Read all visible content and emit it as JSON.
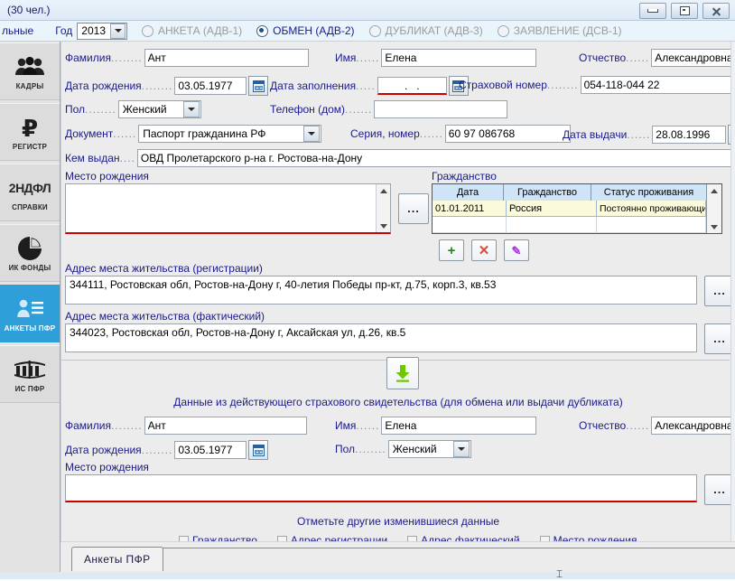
{
  "window": {
    "title": "(30 чел.)",
    "buttons": {
      "minimize": "minimize-button",
      "restore": "restore-button",
      "close": "close-button"
    }
  },
  "toolbar": {
    "truncated_label": "льные",
    "year_label": "Год",
    "year_value": "2013",
    "form_types": [
      {
        "label": "АНКЕТА (АДВ-1)",
        "selected": false
      },
      {
        "label": "ОБМЕН (АДВ-2)",
        "selected": true
      },
      {
        "label": "ДУБЛИКАТ (АДВ-3)",
        "selected": false
      },
      {
        "label": "ЗАЯВЛЕНИЕ (ДСВ-1)",
        "selected": false
      }
    ]
  },
  "sidebar": {
    "items": [
      {
        "label": "КАДРЫ",
        "icon": "people-icon",
        "selected": false
      },
      {
        "label": "РЕГИСТР",
        "icon": "ruble-icon",
        "selected": false
      },
      {
        "label": "СПРАВКИ",
        "top_text": "2НДФЛ",
        "icon": "text-2ndfl-icon",
        "selected": false
      },
      {
        "label": "ИК ФОНДЫ",
        "icon": "pie-chart-icon",
        "selected": false
      },
      {
        "label": "АНКЕТЫ ПФР",
        "icon": "id-card-icon",
        "selected": true
      },
      {
        "label": "ИС ПФР",
        "icon": "pfr-logo-icon",
        "selected": false
      }
    ]
  },
  "form": {
    "surname": {
      "label": "Фамилия",
      "dots": "........",
      "value": "Ант"
    },
    "firstname": {
      "label": "Имя",
      "dots": "......",
      "value": "Елена"
    },
    "patronymic": {
      "label": "Отчество",
      "dots": "......",
      "value": "Александровна"
    },
    "birthdate": {
      "label": "Дата рождения",
      "dots": "........",
      "value": "03.05.1977",
      "icon": "calendar-icon"
    },
    "filldate": {
      "label": "Дата заполнения",
      "dots": ".....",
      "value": ".   .",
      "icon": "calendar-icon",
      "error": true
    },
    "insurance_number": {
      "label": "Страховой номер",
      "dots": "........",
      "value": "054-118-044 22"
    },
    "gender": {
      "label": "Пол",
      "dots": "........",
      "value": "Женский"
    },
    "phone_home": {
      "label": "Телефон (дом)",
      "dots": ".......",
      "value": ""
    },
    "document": {
      "label": "Документ",
      "dots": "......",
      "value": "Паспорт гражданина РФ"
    },
    "series_number": {
      "label": "Серия, номер",
      "dots": "......",
      "value": "60 97 086768"
    },
    "issue_date": {
      "label": "Дата выдачи",
      "dots": "......",
      "value": "28.08.1996",
      "icon": "calendar-icon"
    },
    "issued_by": {
      "label": "Кем выдан",
      "dots": "....",
      "value": "ОВД Пролетарского р-на г. Ростова-на-Дону"
    },
    "birthplace": {
      "label": "Место рождения",
      "value": "",
      "error": true
    },
    "birthplace_browse": "...",
    "citizenship": {
      "label": "Гражданство",
      "columns": [
        "Дата",
        "Гражданство",
        "Статус проживания"
      ],
      "rows": [
        {
          "date": "01.01.2011",
          "citizenship": "Россия",
          "status": "Постоянно проживающий"
        }
      ],
      "actions": [
        {
          "name": "add-row-button",
          "glyph": "+",
          "color": "#1a8a1a"
        },
        {
          "name": "delete-row-button",
          "glyph": "✕",
          "color": "#d94b3a"
        },
        {
          "name": "edit-row-button",
          "glyph": "✎",
          "color": "#a33fd6"
        }
      ]
    },
    "address_registration": {
      "label": "Адрес места жительства (регистрации)",
      "value": "344111, Ростовская обл, Ростов-на-Дону г, 40-летия Победы пр-кт, д.75, корп.3, кв.53",
      "browse": "..."
    },
    "address_actual": {
      "label": "Адрес места жительства (фактический)",
      "value": "344023, Ростовская обл, Ростов-на-Дону г, Аксайская ул, д.26, кв.5",
      "browse": "..."
    }
  },
  "certificate_section": {
    "copy_button": "download-arrow-icon",
    "note": "Данные из действующего страхового свидетельства (для обмена или выдачи дубликата)",
    "surname": {
      "label": "Фамилия",
      "dots": "........",
      "value": "Ант"
    },
    "firstname": {
      "label": "Имя",
      "dots": "......",
      "value": "Елена"
    },
    "patronymic": {
      "label": "Отчество",
      "dots": "......",
      "value": "Александровна"
    },
    "birthdate": {
      "label": "Дата рождения",
      "dots": "........",
      "value": "03.05.1977",
      "icon": "calendar-icon"
    },
    "gender": {
      "label": "Пол",
      "dots": "........",
      "value": "Женский"
    },
    "birthplace": {
      "label": "Место рождения",
      "value": "",
      "error": true
    },
    "birthplace_browse": "..."
  },
  "changed_data": {
    "title": "Отметьте другие изменившиеся данные",
    "checkboxes": [
      {
        "label": "Гражданство",
        "checked": false
      },
      {
        "label": "Адрес регистрации",
        "checked": false
      },
      {
        "label": "Адрес фактический",
        "checked": false
      },
      {
        "label": "Место рождения",
        "checked": false
      }
    ]
  },
  "tabs": {
    "active": "Анкеты  ПФР"
  },
  "colors": {
    "accent": "#2f9fd9",
    "label_blue": "#1a1a8c",
    "error_red": "#d00000",
    "header_blue": "#cfe5f7",
    "row_highlight": "#fbfbdc",
    "green": "#66cc00"
  }
}
